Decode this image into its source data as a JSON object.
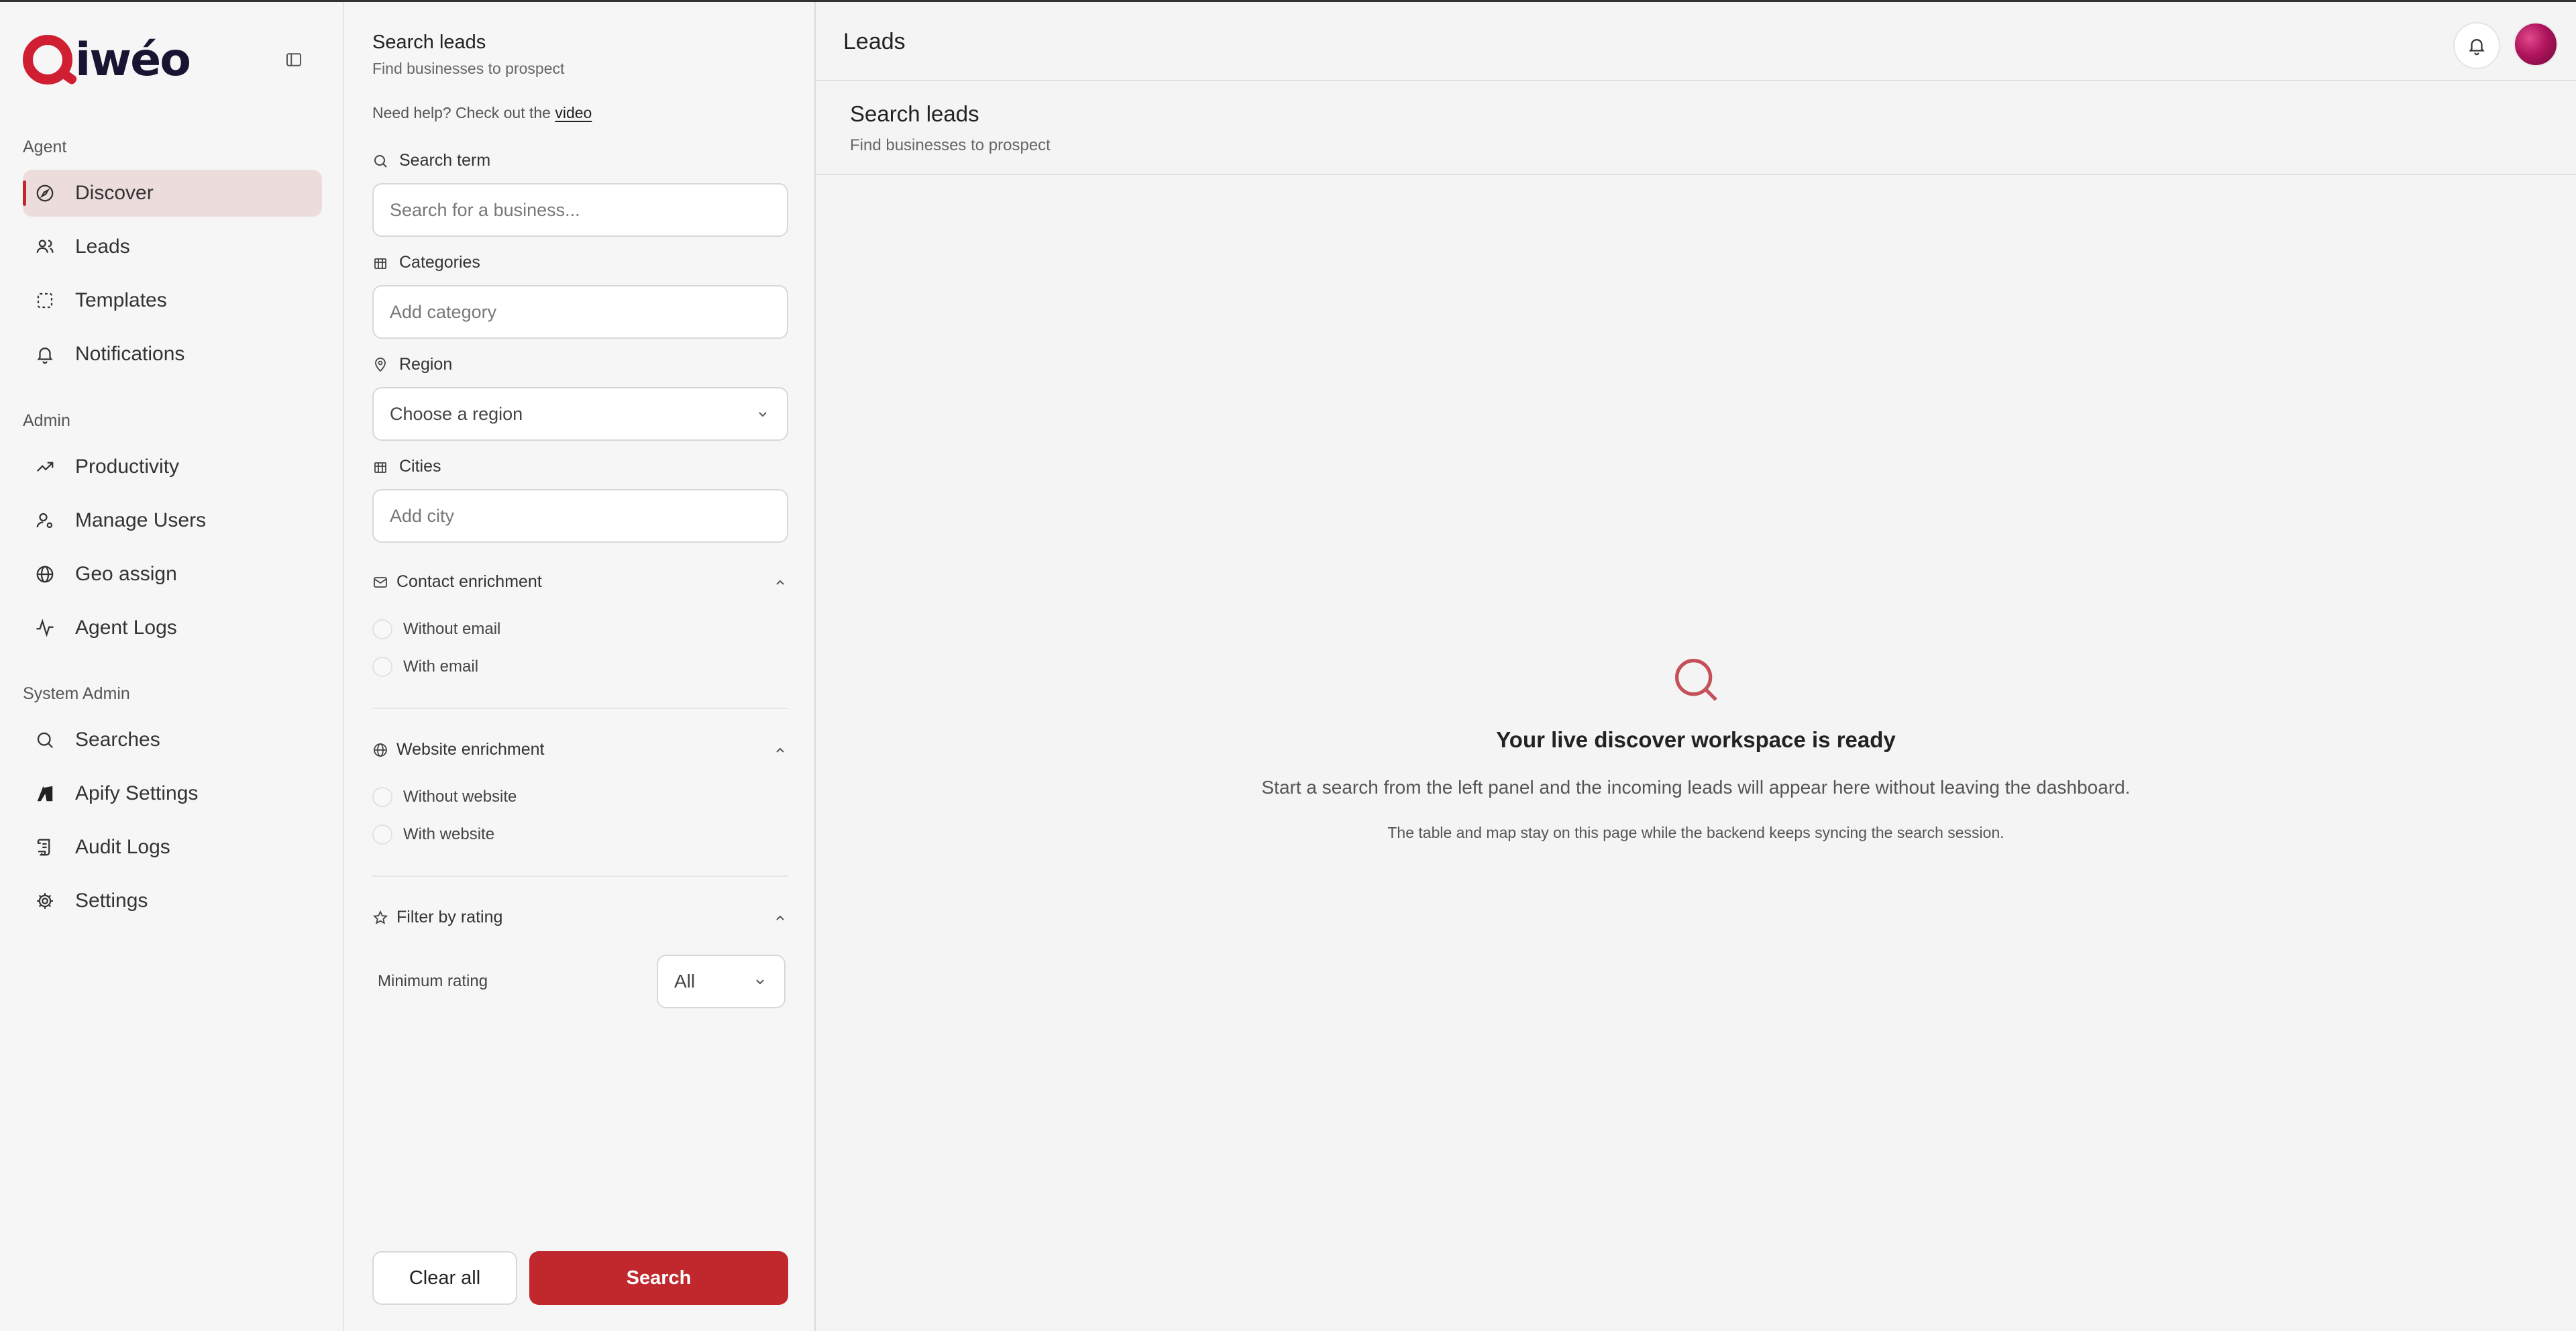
{
  "brand": {
    "name": "iwéo",
    "accent_color": "#c0282d"
  },
  "sidebar": {
    "groups": [
      {
        "label": "Agent",
        "items": [
          {
            "label": "Discover",
            "icon": "compass-icon",
            "active": true
          },
          {
            "label": "Leads",
            "icon": "users-icon"
          },
          {
            "label": "Templates",
            "icon": "dashed-square-icon"
          },
          {
            "label": "Notifications",
            "icon": "bell-icon"
          }
        ]
      },
      {
        "label": "Admin",
        "items": [
          {
            "label": "Productivity",
            "icon": "trending-up-icon"
          },
          {
            "label": "Manage Users",
            "icon": "user-cog-icon"
          },
          {
            "label": "Geo assign",
            "icon": "globe-icon"
          },
          {
            "label": "Agent Logs",
            "icon": "activity-icon"
          }
        ]
      },
      {
        "label": "System Admin",
        "items": [
          {
            "label": "Searches",
            "icon": "search-icon"
          },
          {
            "label": "Apify Settings",
            "icon": "apify-logo-icon"
          },
          {
            "label": "Audit Logs",
            "icon": "scroll-icon"
          },
          {
            "label": "Settings",
            "icon": "gear-icon"
          }
        ]
      }
    ]
  },
  "filter": {
    "title": "Search leads",
    "subtitle": "Find businesses to prospect",
    "help_prefix": "Need help? Check out the",
    "help_link": "video",
    "search_term": {
      "label": "Search term",
      "placeholder": "Search for a business..."
    },
    "categories": {
      "label": "Categories",
      "placeholder": "Add category"
    },
    "region": {
      "label": "Region",
      "value": "Choose a region"
    },
    "cities": {
      "label": "Cities",
      "placeholder": "Add city"
    },
    "contact": {
      "label": "Contact enrichment",
      "options": [
        "Without email",
        "With email"
      ]
    },
    "website": {
      "label": "Website enrichment",
      "options": [
        "Without website",
        "With website"
      ]
    },
    "rating": {
      "label": "Filter by rating",
      "min_label": "Minimum rating",
      "value": "All"
    },
    "clear_label": "Clear all",
    "search_label": "Search"
  },
  "main": {
    "topbar_title": "Leads",
    "header_title": "Search leads",
    "header_subtitle": "Find businesses to prospect",
    "empty_title": "Your live discover workspace is ready",
    "empty_text": "Start a search from the left panel and the incoming leads will appear here without leaving the dashboard.",
    "empty_note": "The table and map stay on this page while the backend keeps syncing the search session."
  }
}
